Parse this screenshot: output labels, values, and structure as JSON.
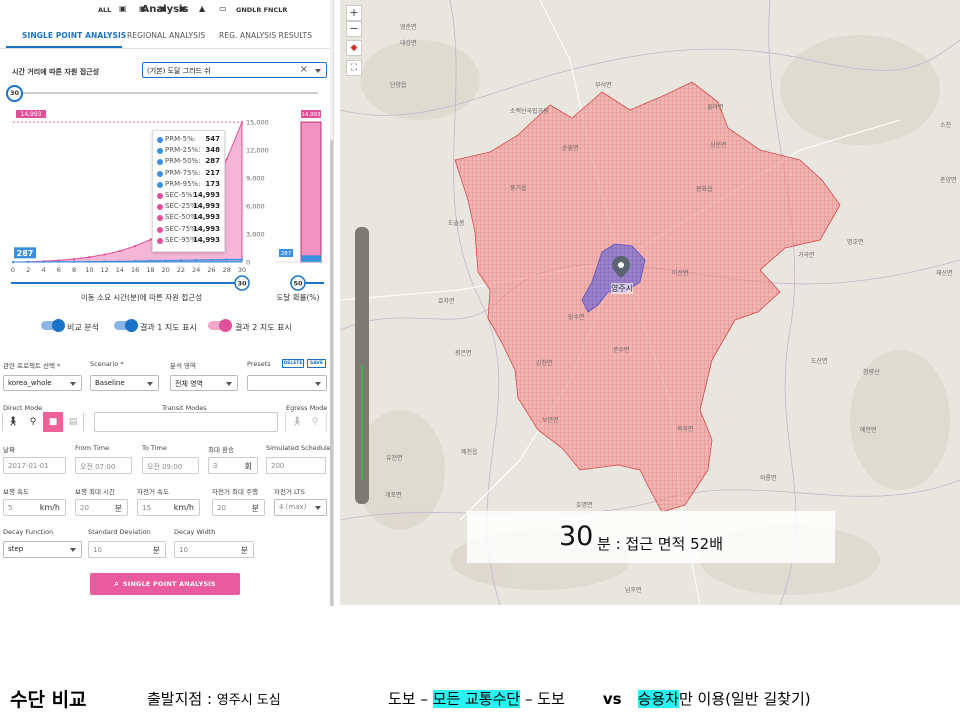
{
  "panel": {
    "title": "Analysis",
    "tabs": [
      {
        "label": "SINGLE POINT ANALYSIS",
        "active": true
      },
      {
        "label": "REGIONAL ANALYSIS",
        "active": false
      },
      {
        "label": "REG. ANALYSIS RESULTS",
        "active": false
      }
    ],
    "access_label": "시간 거리에 따른 자원 접근성",
    "grid_select": "(기본) 도달 그리드 쉬",
    "time_slider_value": "30",
    "chart": {
      "main_badge_left": "287",
      "main_badge_top": "14,993",
      "side_badge_top": "14,993",
      "side_badge_bottom": "287",
      "x_label": "이동 소요 시간(분)에 따른 자원 접근성",
      "side_label": "도달 확률(%)",
      "time_knob": "30",
      "prob_knob": "50"
    },
    "tooltip": [
      {
        "key": "PRM-5%:",
        "value": "547",
        "color": "#3a8fe0"
      },
      {
        "key": "PRM-25%:",
        "value": "348",
        "color": "#3a8fe0"
      },
      {
        "key": "PRM-50%:",
        "value": "287",
        "color": "#3a8fe0"
      },
      {
        "key": "PRM-75%:",
        "value": "217",
        "color": "#3a8fe0"
      },
      {
        "key": "PRM-95%:",
        "value": "173",
        "color": "#3a8fe0"
      },
      {
        "key": "SEC-5%:",
        "value": "14,993",
        "color": "#e0509a"
      },
      {
        "key": "SEC-25%:",
        "value": "14,993",
        "color": "#e0509a"
      },
      {
        "key": "SEC-50%:",
        "value": "14,993",
        "color": "#e0509a"
      },
      {
        "key": "SEC-75%:",
        "value": "14,993",
        "color": "#e0509a"
      },
      {
        "key": "SEC-95%:",
        "value": "14,993",
        "color": "#e0509a"
      }
    ],
    "toggles": [
      "비교 분석",
      "결과 1 지도 표시",
      "결과 2 지도 표시"
    ],
    "form": {
      "project_label": "관련 프로젝트 선택 *",
      "project_value": "korea_whole",
      "scenario_label": "Scenario *",
      "scenario_value": "Baseline",
      "area_label": "분석 영역",
      "area_value": "전체 영역",
      "presets_label": "Presets",
      "delete_label": "DELETE",
      "save_label": "SAVE",
      "direct_mode": "Direct Mode",
      "transit_modes": "Transit Modes",
      "egress_mode": "Egress Mode",
      "transit_all": "ALL",
      "transit_extra": "GNDLR FNCLR",
      "date_label": "날짜",
      "date_value": "2017-01-01",
      "from_label": "From Time",
      "from_value": "오전 07:00",
      "to_label": "To Time",
      "to_value": "오전 09:00",
      "transfer_label": "최대 환승",
      "transfer_value": "3",
      "transfer_unit": "회",
      "sim_label": "Simulated Schedule",
      "sim_value": "200",
      "walk_speed_label": "보행 속도",
      "walk_speed_value": "5",
      "walk_speed_unit": "km/h",
      "walk_max_label": "보행 최대 시간",
      "walk_max_value": "20",
      "walk_max_unit": "분",
      "bike_speed_label": "자전거 속도",
      "bike_speed_value": "15",
      "bike_speed_unit": "km/h",
      "bike_max_label": "자전거 최대 주행",
      "bike_max_value": "20",
      "bike_max_unit": "분",
      "bike_lts_label": "자전거 LTS",
      "bike_lts_value": "4 (max)",
      "decay_label": "Decay Function",
      "decay_value": "step",
      "std_label": "Standard Deviation",
      "std_value": "10",
      "std_unit": "분",
      "width_label": "Decay Width",
      "width_value": "10",
      "width_unit": "분"
    },
    "run_button": "SINGLE POINT ANALYSIS"
  },
  "chart_data": {
    "type": "area",
    "x": [
      0,
      2,
      4,
      6,
      8,
      10,
      12,
      14,
      16,
      18,
      20,
      22,
      24,
      26,
      28,
      30
    ],
    "series": [
      {
        "values": [
          0,
          30,
          90,
          180,
          320,
          520,
          800,
          1180,
          1700,
          2400,
          3300,
          4500,
          6100,
          8200,
          11000,
          14993
        ],
        "color": "#e0509a"
      },
      {
        "values": [
          0,
          5,
          12,
          20,
          30,
          45,
          60,
          80,
          100,
          125,
          150,
          180,
          210,
          240,
          265,
          287
        ],
        "color": "#3a8fe0"
      }
    ],
    "xlim": [
      0,
      30
    ],
    "ylim": [
      0,
      15000
    ],
    "y_ticks": [
      "15,000",
      "12,000",
      "9,000",
      "6,000",
      "3,000",
      "0"
    ],
    "x_ticks": [
      "0",
      "2",
      "4",
      "6",
      "8",
      "10",
      "12",
      "14",
      "16",
      "18",
      "20",
      "22",
      "24",
      "26",
      "28",
      "30"
    ],
    "side_bar": {
      "primary": 287,
      "secondary": 14993
    },
    "xlabel": "이동 소요 시간(분)에 따른 자원 접근성",
    "side_label": "도달 확률(%)"
  },
  "map": {
    "zoom_in": "+",
    "zoom_out": "−",
    "places": [
      {
        "name": "단양읍"
      },
      {
        "name": "소백산국립공원"
      },
      {
        "name": "순흥면"
      },
      {
        "name": "풍기읍"
      },
      {
        "name": "봉화읍"
      },
      {
        "name": "물야면"
      },
      {
        "name": "상운면"
      },
      {
        "name": "이산면"
      },
      {
        "name": "영주시"
      },
      {
        "name": "장수면"
      },
      {
        "name": "평은면"
      },
      {
        "name": "문수면"
      },
      {
        "name": "효자면"
      },
      {
        "name": "감천면"
      },
      {
        "name": "보문면"
      },
      {
        "name": "북후면"
      },
      {
        "name": "예천읍"
      },
      {
        "name": "유천면"
      },
      {
        "name": "개포면"
      },
      {
        "name": "호명면"
      },
      {
        "name": "풍산읍"
      },
      {
        "name": "남후면"
      },
      {
        "name": "와룡면"
      },
      {
        "name": "도산면"
      },
      {
        "name": "청량산"
      },
      {
        "name": "명호면"
      },
      {
        "name": "재산면"
      },
      {
        "name": "춘양면"
      },
      {
        "name": "가곡면"
      },
      {
        "name": "대강면"
      },
      {
        "name": "도솔봉"
      },
      {
        "name": "영춘면"
      },
      {
        "name": "부석면"
      },
      {
        "name": "예안면"
      },
      {
        "name": "소천"
      }
    ]
  },
  "overlay": {
    "number": "30",
    "text": "분 : 접근 면적 52배"
  },
  "caption": {
    "title": "수단 비교",
    "origin_label": "출발지점 : ",
    "origin_value": "영주시 도심",
    "walk1": "도보 – ",
    "all_modes": "모든 교통수단",
    "walk2": " – 도보",
    "vs": "vs",
    "car": "승용차",
    "car_rest": "만 이용(일반 길찾기)"
  }
}
